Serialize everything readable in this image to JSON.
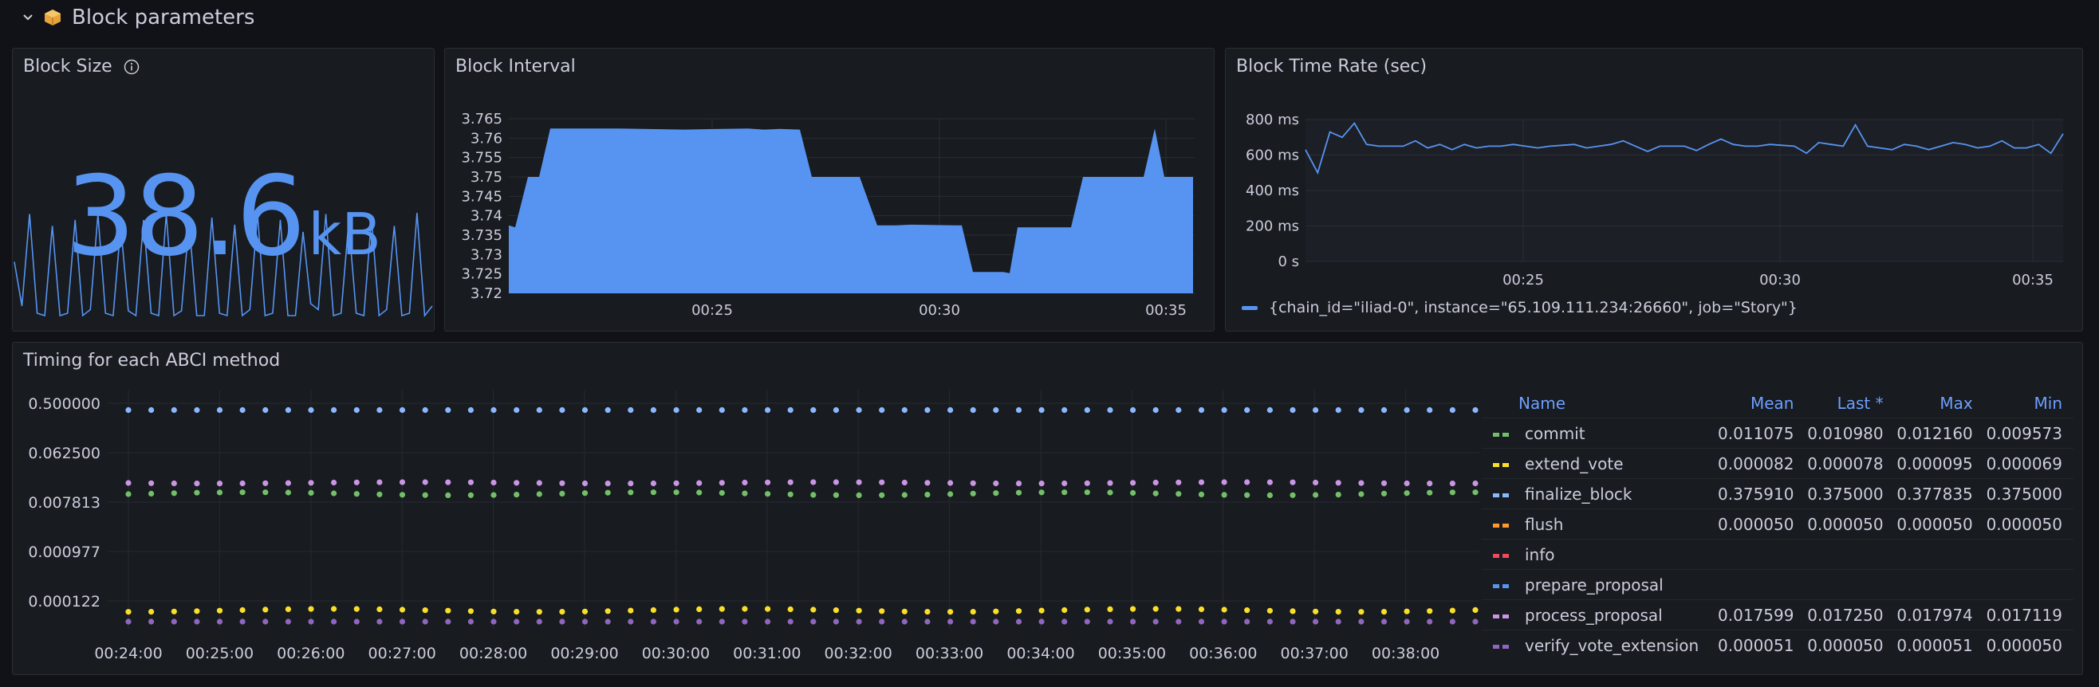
{
  "row": {
    "title": "Block parameters",
    "icon": "package-icon"
  },
  "block_size": {
    "title": "Block Size",
    "value": "38.6",
    "unit": "kB",
    "color": "#5794f2",
    "sparkline": [
      0.55,
      0.18,
      0.95,
      0.12,
      0.1,
      0.85,
      0.1,
      0.12,
      0.9,
      0.1,
      0.15,
      0.95,
      0.12,
      0.1,
      0.85,
      0.14,
      0.1,
      0.9,
      0.12,
      0.1,
      0.95,
      0.1,
      0.14,
      0.88,
      0.1,
      0.1,
      0.92,
      0.12,
      0.1,
      0.86,
      0.1,
      0.15,
      0.95,
      0.1,
      0.12,
      0.9,
      0.1,
      0.1,
      0.8,
      0.2,
      0.15,
      0.95,
      0.1,
      0.12,
      0.88,
      0.12,
      0.1,
      0.92,
      0.1,
      0.15,
      0.85,
      0.1,
      0.12,
      0.96,
      0.1,
      0.18
    ]
  },
  "block_interval": {
    "title": "Block Interval",
    "color": "#5794f2",
    "y_ticks": [
      "3.765",
      "3.76",
      "3.755",
      "3.75",
      "3.745",
      "3.74",
      "3.735",
      "3.73",
      "3.725",
      "3.72"
    ],
    "x_ticks": [
      "00:25",
      "00:30",
      "00:35"
    ]
  },
  "block_time_rate": {
    "title": "Block Time Rate (sec)",
    "color": "#5794f2",
    "y_ticks": [
      "800 ms",
      "600 ms",
      "400 ms",
      "200 ms",
      "0 s"
    ],
    "x_ticks": [
      "00:25",
      "00:30",
      "00:35"
    ],
    "legend": "{chain_id=\"iliad-0\", instance=\"65.109.111.234:26660\", job=\"Story\"}"
  },
  "abci": {
    "title": "Timing for each ABCI method",
    "y_ticks": [
      "0.500000",
      "0.062500",
      "0.007813",
      "0.000977",
      "0.000122"
    ],
    "x_ticks": [
      "00:24:00",
      "00:25:00",
      "00:26:00",
      "00:27:00",
      "00:28:00",
      "00:29:00",
      "00:30:00",
      "00:31:00",
      "00:32:00",
      "00:33:00",
      "00:34:00",
      "00:35:00",
      "00:36:00",
      "00:37:00",
      "00:38:00"
    ],
    "columns": {
      "name": "Name",
      "mean": "Mean",
      "last": "Last *",
      "max": "Max",
      "min": "Min"
    },
    "series": [
      {
        "name": "commit",
        "color": "#73bf69",
        "mean": "0.011075",
        "last": "0.010980",
        "max": "0.012160",
        "min": "0.009573"
      },
      {
        "name": "extend_vote",
        "color": "#fade2a",
        "mean": "0.000082",
        "last": "0.000078",
        "max": "0.000095",
        "min": "0.000069"
      },
      {
        "name": "finalize_block",
        "color": "#8ab8ff",
        "mean": "0.375910",
        "last": "0.375000",
        "max": "0.377835",
        "min": "0.375000"
      },
      {
        "name": "flush",
        "color": "#ff9830",
        "mean": "0.000050",
        "last": "0.000050",
        "max": "0.000050",
        "min": "0.000050"
      },
      {
        "name": "info",
        "color": "#f2495c",
        "mean": "",
        "last": "",
        "max": "",
        "min": ""
      },
      {
        "name": "prepare_proposal",
        "color": "#5794f2",
        "mean": "",
        "last": "",
        "max": "",
        "min": ""
      },
      {
        "name": "process_proposal",
        "color": "#ca95e5",
        "mean": "0.017599",
        "last": "0.017250",
        "max": "0.017974",
        "min": "0.017119"
      },
      {
        "name": "verify_vote_extension",
        "color": "#8f66bd",
        "mean": "0.000051",
        "last": "0.000050",
        "max": "0.000051",
        "min": "0.000050"
      }
    ]
  }
}
